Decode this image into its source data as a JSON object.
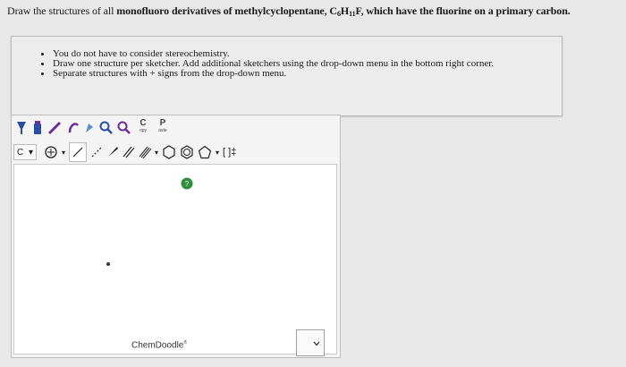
{
  "question": {
    "prefix": "Draw the structures of all",
    "bold_part": "monofluoro derivatives of methylcyclopentane, C",
    "sub1": "6",
    "h": "H",
    "sub2": "11",
    "bold_tail": "F, which have the fluorine on a primary carbon."
  },
  "instructions": [
    "You do not have to consider stereochemistry.",
    "Draw one structure per sketcher. Add additional sketchers using the drop-down menu in the bottom right corner.",
    "Separate structures with + signs from the drop-down menu."
  ],
  "toolbar": {
    "copy": {
      "letter": "C",
      "sub": "opy"
    },
    "paste": {
      "letter": "P",
      "sub": "aste"
    },
    "element_select": "C",
    "atom_label": "[ ]‡"
  },
  "sketcher": {
    "brand": "ChemDoodle",
    "brand_mark": "®"
  },
  "colors": {
    "help_green": "#2f8f3f",
    "tool_blue": "#2b4f9e",
    "tool_purple": "#6a2f98"
  }
}
